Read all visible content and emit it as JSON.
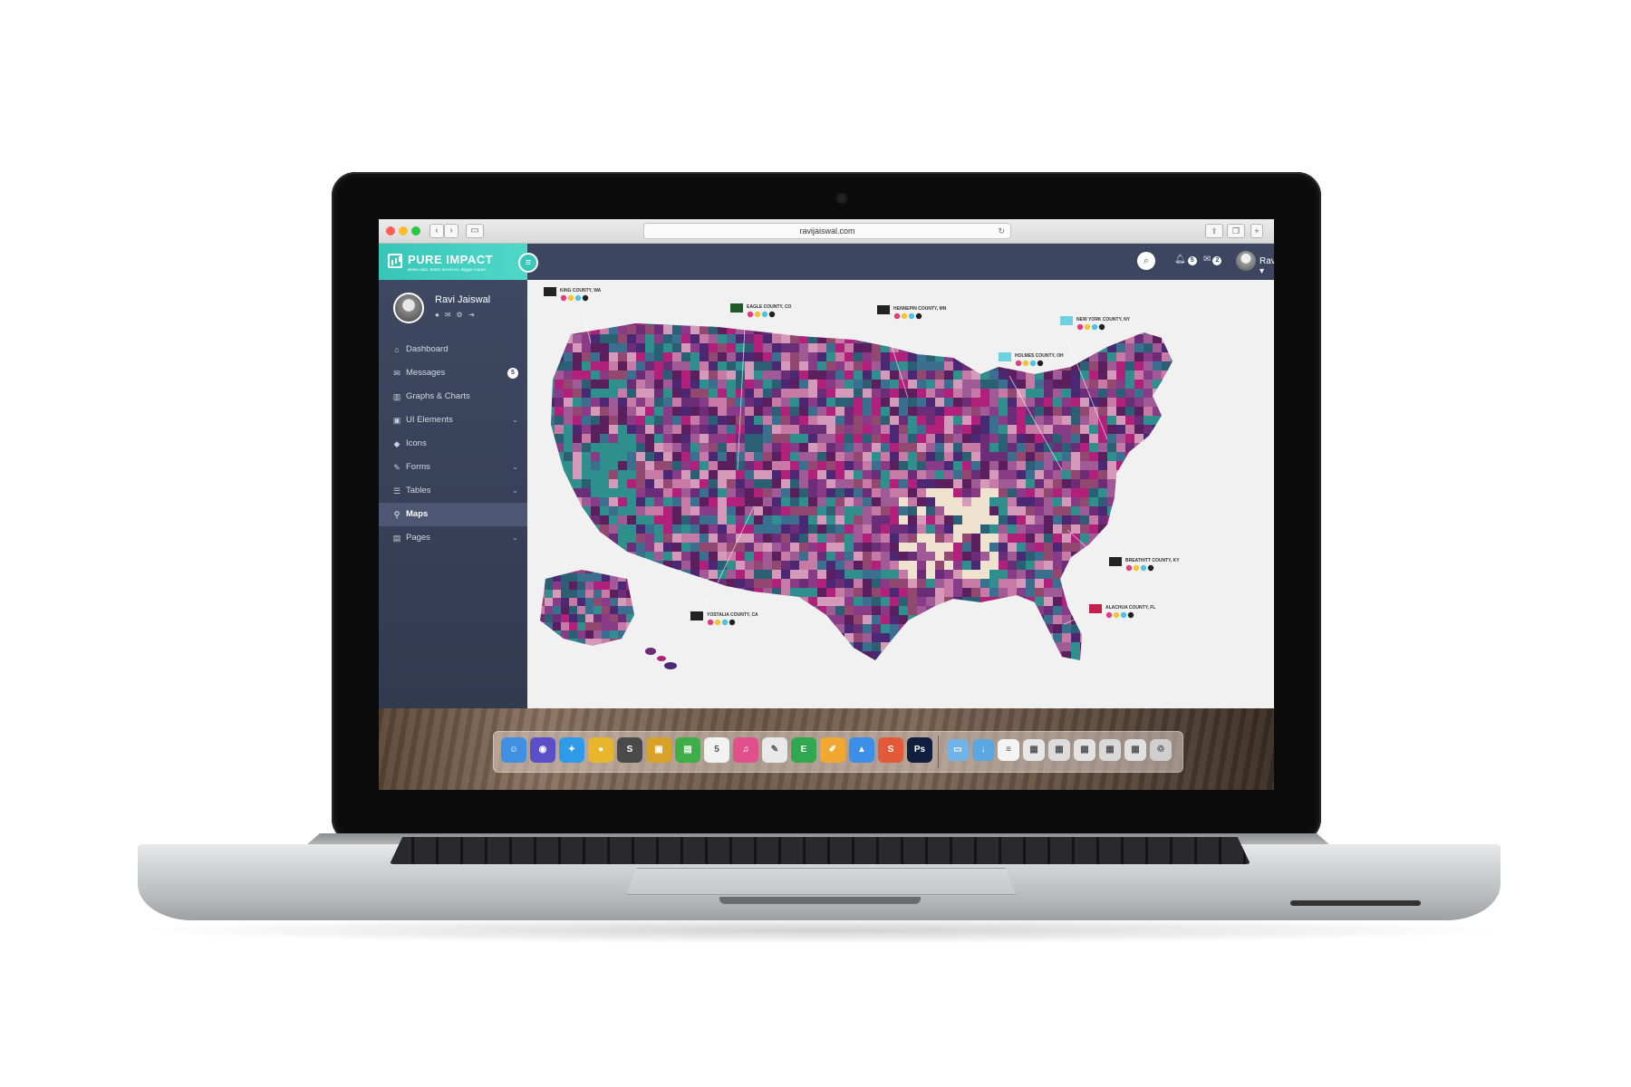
{
  "browser": {
    "url": "ravijaiswal.com"
  },
  "brand": {
    "name": "PURE IMPACT",
    "tagline": "Better data. Better decisions. Bigger impact."
  },
  "topbar": {
    "notifications_count": "5",
    "messages_count": "2",
    "user_name": "Ravi"
  },
  "sidebar": {
    "user_name": "Ravi Jaiswal",
    "items": [
      {
        "label": "Dashboard",
        "icon": "home-icon",
        "badge": "",
        "has_chevron": false,
        "active": false
      },
      {
        "label": "Messages",
        "icon": "envelope-icon",
        "badge": "5",
        "has_chevron": false,
        "active": false
      },
      {
        "label": "Graphs & Charts",
        "icon": "bar-chart-icon",
        "badge": "",
        "has_chevron": false,
        "active": false
      },
      {
        "label": "UI Elements",
        "icon": "briefcase-icon",
        "badge": "",
        "has_chevron": true,
        "active": false
      },
      {
        "label": "Icons",
        "icon": "cube-icon",
        "badge": "",
        "has_chevron": false,
        "active": false
      },
      {
        "label": "Forms",
        "icon": "edit-icon",
        "badge": "",
        "has_chevron": true,
        "active": false
      },
      {
        "label": "Tables",
        "icon": "list-icon",
        "badge": "",
        "has_chevron": true,
        "active": false
      },
      {
        "label": "Maps",
        "icon": "map-marker-icon",
        "badge": "",
        "has_chevron": false,
        "active": true
      },
      {
        "label": "Pages",
        "icon": "file-icon",
        "badge": "",
        "has_chevron": true,
        "active": false
      }
    ]
  },
  "map": {
    "callouts": [
      {
        "label": "KING COUNTY, WA"
      },
      {
        "label": "EAGLE COUNTY, CO"
      },
      {
        "label": "HENNEPIN COUNTY, MN"
      },
      {
        "label": "NEW YORK COUNTY, NY"
      },
      {
        "label": "HOLMES COUNTY, OH"
      },
      {
        "label": "BREATHITT COUNTY, KY"
      },
      {
        "label": "ALACHUA COUNTY, FL"
      },
      {
        "label": "YOSTALIA COUNTY, CA"
      }
    ],
    "colors": {
      "magenta": "#b1207a",
      "purple": "#4a2873",
      "teal": "#2f8f8d",
      "pink": "#c77aa6",
      "cream": "#efe3d0"
    }
  },
  "dock": {
    "apps": [
      {
        "name": "finder-icon",
        "color": "#3f8fe3",
        "glyph": "☺"
      },
      {
        "name": "siri-icon",
        "color": "#5b4fc9",
        "glyph": "◉"
      },
      {
        "name": "safari-icon",
        "color": "#2f9be8",
        "glyph": "✦"
      },
      {
        "name": "chrome-icon",
        "color": "#e8b62d",
        "glyph": "●"
      },
      {
        "name": "sublime-icon",
        "color": "#4a4a4a",
        "glyph": "S"
      },
      {
        "name": "transmit-icon",
        "color": "#d7a227",
        "glyph": "▣"
      },
      {
        "name": "numbers-icon",
        "color": "#3fae49",
        "glyph": "▤"
      },
      {
        "name": "calendar-icon",
        "color": "#f2f2f2",
        "glyph": "5"
      },
      {
        "name": "itunes-icon",
        "color": "#e0508c",
        "glyph": "♫"
      },
      {
        "name": "textedit-icon",
        "color": "#e9e9e9",
        "glyph": "✎"
      },
      {
        "name": "evernote-icon",
        "color": "#2fa84f",
        "glyph": "E"
      },
      {
        "name": "pages-icon",
        "color": "#f0a830",
        "glyph": "✐"
      },
      {
        "name": "keynote-icon",
        "color": "#3c8ee6",
        "glyph": "▲"
      },
      {
        "name": "sketch-icon",
        "color": "#e35a3a",
        "glyph": "S"
      },
      {
        "name": "photoshop-icon",
        "color": "#0f1f3d",
        "glyph": "Ps"
      },
      {
        "name": "folder-icon",
        "color": "#6fb3e8",
        "glyph": "▭"
      },
      {
        "name": "downloads-icon",
        "color": "#5aa6e0",
        "glyph": "↓"
      },
      {
        "name": "document-stack-icon",
        "color": "#f4f4f4",
        "glyph": "≡"
      },
      {
        "name": "screenshot-icon",
        "color": "#e7e7e7",
        "glyph": "▦"
      },
      {
        "name": "screenshot-icon",
        "color": "#dcdcdc",
        "glyph": "▦"
      },
      {
        "name": "screenshot-icon",
        "color": "#e3e3e3",
        "glyph": "▦"
      },
      {
        "name": "screenshot-icon",
        "color": "#d9d9d9",
        "glyph": "▦"
      },
      {
        "name": "screenshot-icon",
        "color": "#e0e0e0",
        "glyph": "▦"
      },
      {
        "name": "trash-icon",
        "color": "#cfcfcf",
        "glyph": "♲"
      }
    ]
  }
}
